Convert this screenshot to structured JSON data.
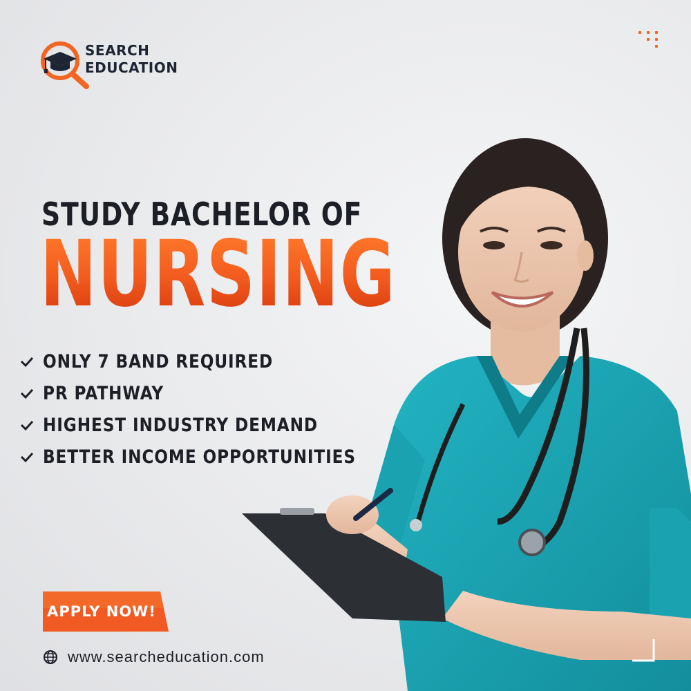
{
  "brand": {
    "line1": "SEARCH",
    "line2": "EDUCATION",
    "icon": "graduation-cap-magnifier-icon",
    "accent_color": "#f26522",
    "dark_color": "#1d2433"
  },
  "headline": {
    "top": "STUDY BACHELOR OF",
    "main": "NURSING"
  },
  "features": [
    {
      "label": "ONLY 7 BAND REQUIRED",
      "icon": "check-icon"
    },
    {
      "label": "PR PATHWAY",
      "icon": "check-icon"
    },
    {
      "label": "HIGHEST INDUSTRY DEMAND",
      "icon": "check-icon"
    },
    {
      "label": "BETTER INCOME OPPORTUNITIES",
      "icon": "check-icon"
    }
  ],
  "cta": {
    "label": "APPLY NOW!",
    "color": "#f15a22"
  },
  "website": {
    "url": "www.searcheducation.com",
    "icon": "globe-icon"
  },
  "photo": {
    "subject": "nurse-with-clipboard-and-stethoscope",
    "scrub_color": "#1aa6b5"
  }
}
